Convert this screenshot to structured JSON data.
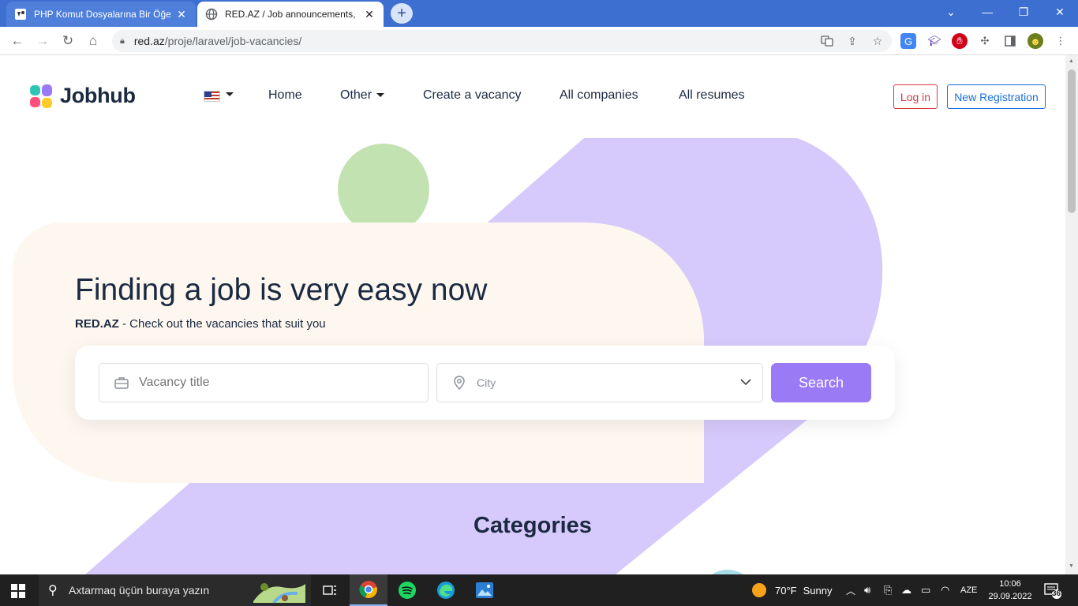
{
  "browser": {
    "tabs": [
      {
        "title": "PHP Komut Dosyalarına Bir Öğe Y",
        "active": false
      },
      {
        "title": "RED.AZ / Job announcements, lat",
        "active": true
      }
    ],
    "url_host": "red.az",
    "url_path": "/proje/laravel/job-vacancies/",
    "ext_badge": "18"
  },
  "site": {
    "logo_text": "Jobhub",
    "nav": {
      "home": "Home",
      "other": "Other",
      "create": "Create a vacancy",
      "companies": "All companies",
      "resumes": "All resumes"
    },
    "login": "Log in",
    "register": "New Registration"
  },
  "hero": {
    "title": "Finding a job is very easy now",
    "sub_brand": "RED.AZ",
    "sub_text": " - Check out the vacancies that suit you",
    "vacancy_placeholder": "Vacancy title",
    "city_placeholder": "City",
    "search_button": "Search"
  },
  "sections": {
    "categories": "Categories"
  },
  "taskbar": {
    "search_placeholder": "Axtarmaq üçün buraya yazın",
    "weather_temp": "70°F",
    "weather_text": "Sunny",
    "lang": "AZE",
    "time": "10:06",
    "date": "29.09.2022",
    "notification_count": "36"
  },
  "colors": {
    "tabbar": "#3c6fd0",
    "accent_purple": "#9b7af5",
    "blob_purple": "#d6c9fb",
    "hero_cream": "#fdf7f0",
    "circle_green": "#c2e3b1",
    "login_red": "#dc3545",
    "register_blue": "#1a6fd9"
  }
}
